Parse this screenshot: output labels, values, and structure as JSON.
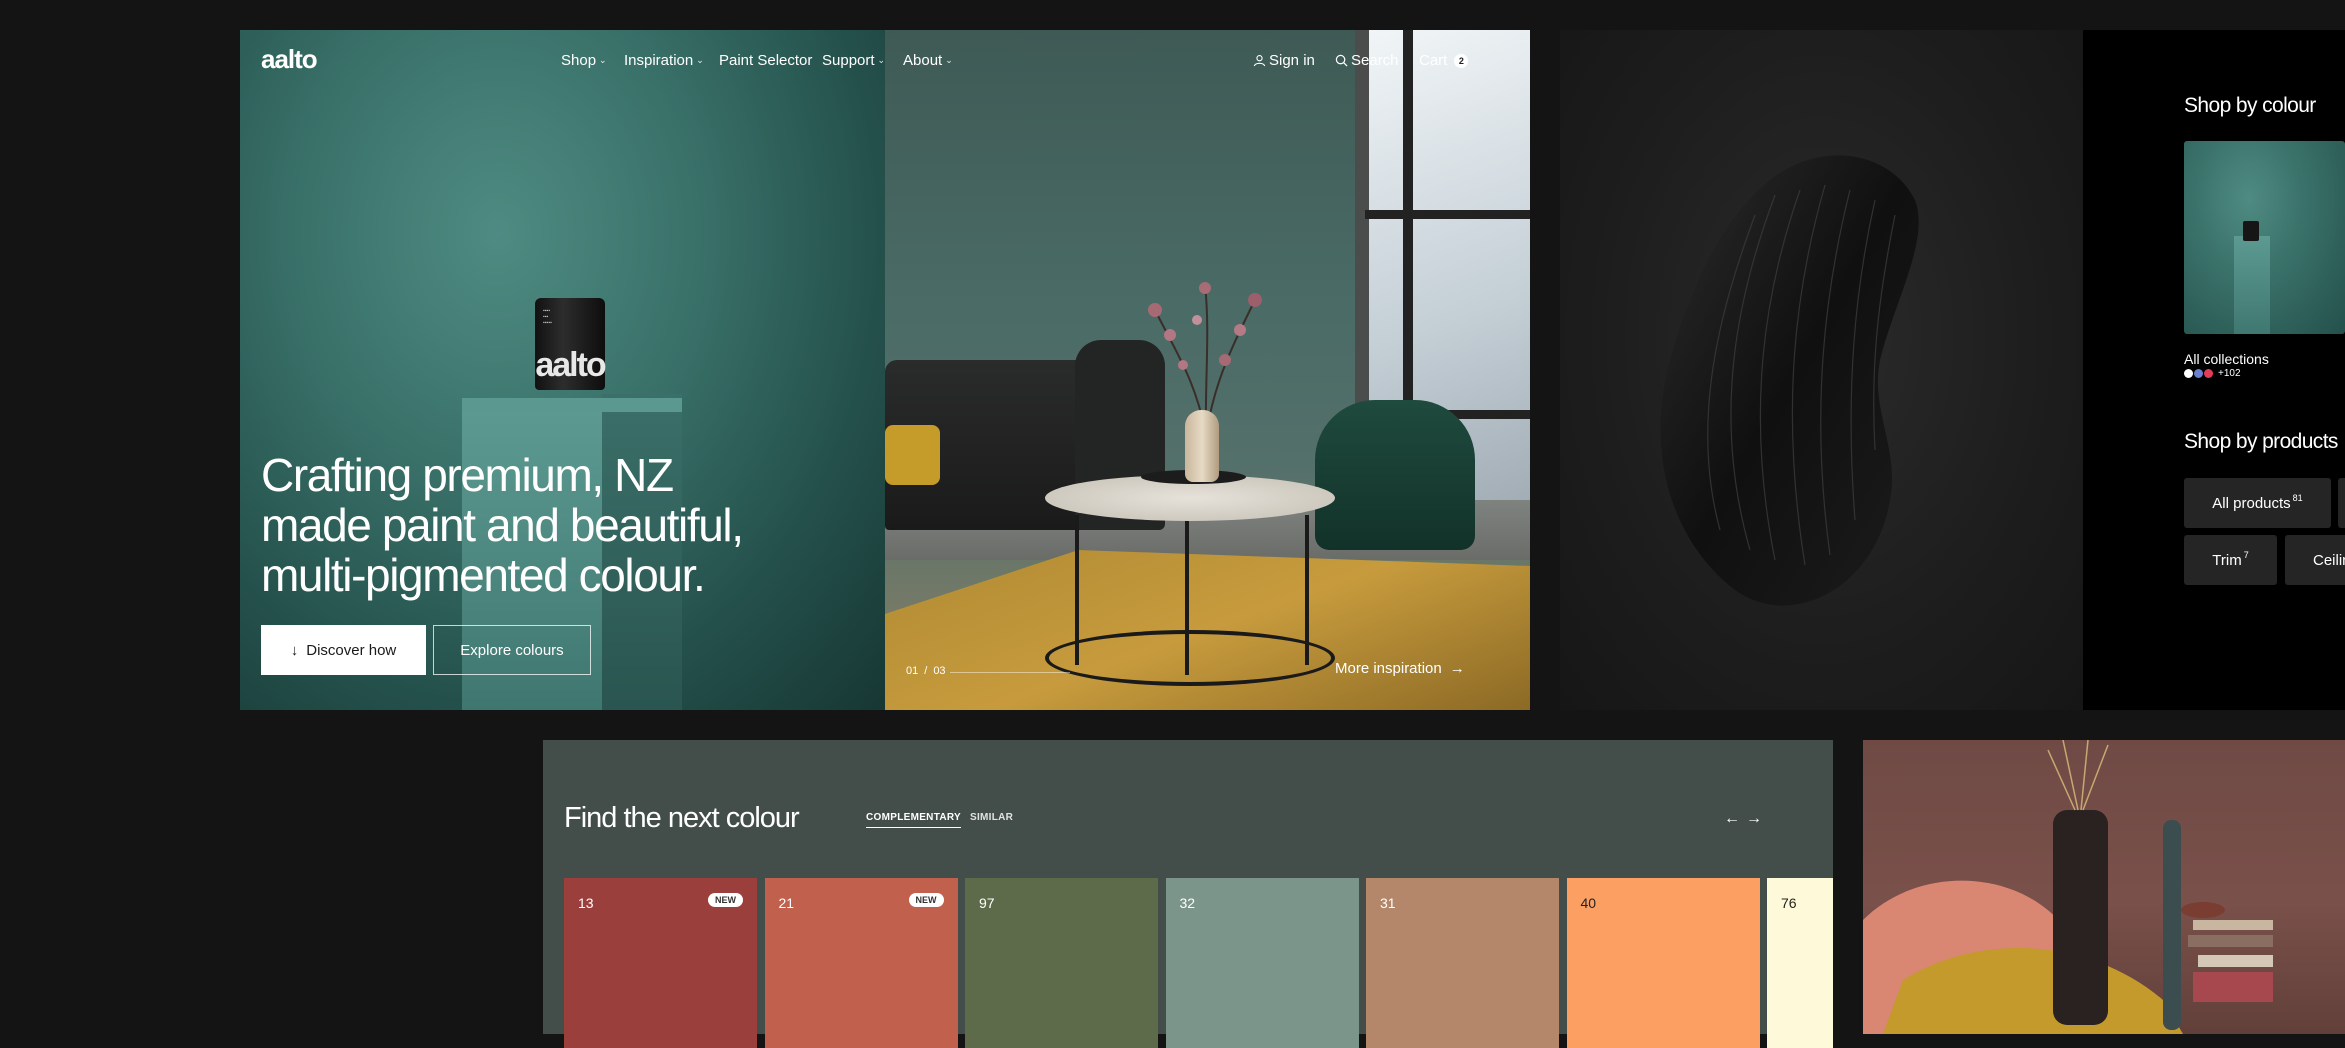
{
  "brand": {
    "logo": "aalto",
    "can_logo": "aalto"
  },
  "nav": {
    "shop": "Shop",
    "inspiration": "Inspiration",
    "paint_selector": "Paint Selector",
    "support": "Support",
    "about": "About",
    "sign_in": "Sign in",
    "search": "Search",
    "cart": "Cart",
    "cart_count": "2"
  },
  "hero": {
    "title": "Crafting premium, NZ made paint and beautiful, multi-pigmented colour.",
    "discover_label": "Discover how",
    "explore_label": "Explore colours",
    "slide_current": "01",
    "slide_sep": "/",
    "slide_total": "03",
    "more_label": "More inspiration"
  },
  "shop_panel": {
    "colour_title": "Shop by colour",
    "collection_label": "All collections",
    "collection_extra": "+102",
    "products_title": "Shop by products",
    "products": [
      {
        "label": "All products",
        "count": "81"
      },
      {
        "label": "Trim",
        "count": "7"
      },
      {
        "label": "Ceilin",
        "count": ""
      }
    ]
  },
  "finder": {
    "title": "Find the next colour",
    "tab_complementary": "COMPLEMENTARY",
    "tab_similar": "SIMILAR",
    "swatches": [
      {
        "num": "13",
        "badge": "NEW",
        "color": "#9b3f3c"
      },
      {
        "num": "21",
        "badge": "NEW",
        "color": "#c1604c"
      },
      {
        "num": "97",
        "badge": "",
        "color": "#5d6b4a"
      },
      {
        "num": "32",
        "badge": "",
        "color": "#7b958b"
      },
      {
        "num": "31",
        "badge": "",
        "color": "#b4866a"
      },
      {
        "num": "40",
        "badge": "",
        "color": "#fba062",
        "dark_text": true
      },
      {
        "num": "76",
        "badge": "",
        "color": "#fef9d9",
        "dark_text": true
      }
    ]
  },
  "colors": {
    "accent_teal": "#3a726a",
    "dot_1": "#ffffff",
    "dot_2": "#6a7fd0",
    "dot_3": "#e23c5b"
  }
}
